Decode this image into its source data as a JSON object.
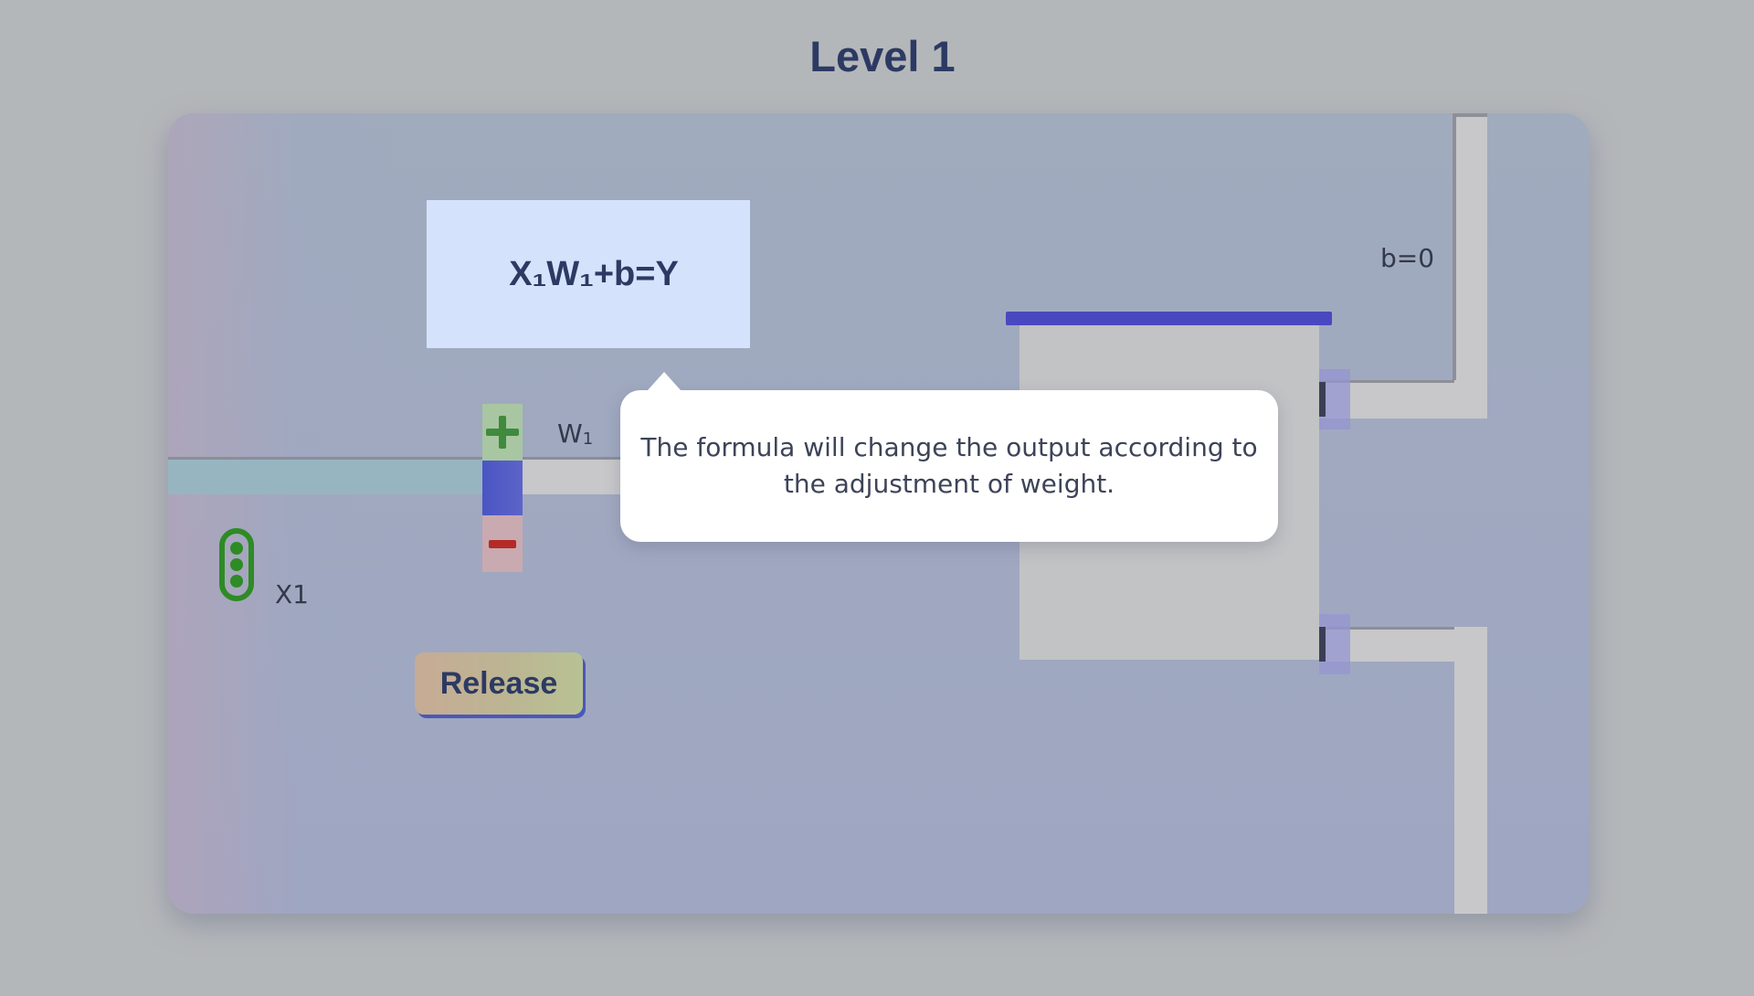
{
  "level": {
    "title": "Level 1"
  },
  "formula": {
    "text": "X₁W₁+b=Y"
  },
  "bias": {
    "label": "b=0"
  },
  "weight": {
    "label": "W",
    "subscript": "1"
  },
  "input": {
    "label": "X1"
  },
  "buttons": {
    "release_label": "Release"
  },
  "tooltip": {
    "text": "The formula will change the output according to the adjustment of weight."
  },
  "colors": {
    "background": "#b4b7ba",
    "title": "#2c3a63",
    "formula_box": "#d5e2fb",
    "weight_block": "#4b55c3",
    "plus": "#3f8a3c",
    "minus": "#b52a26",
    "sensor": "#2e8b25",
    "top_bar": "#4a48c0"
  },
  "icons": {
    "plus": "plus-icon",
    "minus": "minus-icon",
    "sensor": "sensor-icon"
  }
}
